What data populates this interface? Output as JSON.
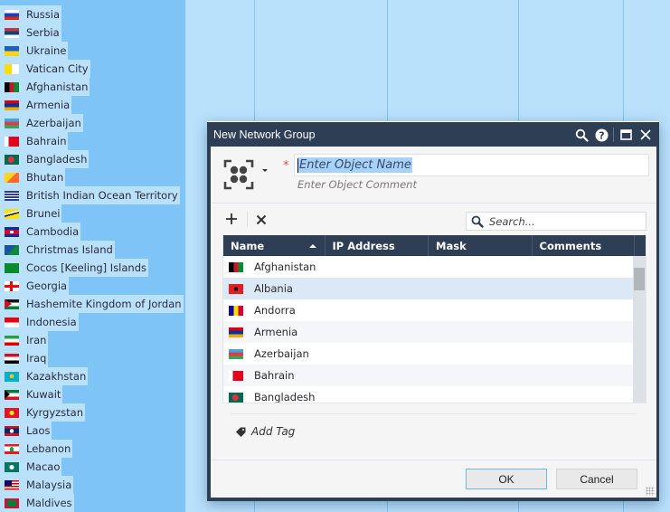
{
  "background": {
    "countries": [
      {
        "name": "Russia",
        "flag": "russia"
      },
      {
        "name": "Serbia",
        "flag": "serbia"
      },
      {
        "name": "Ukraine",
        "flag": "ukraine"
      },
      {
        "name": "Vatican City",
        "flag": "vatican"
      },
      {
        "name": "Afghanistan",
        "flag": "afghanistan"
      },
      {
        "name": "Armenia",
        "flag": "armenia"
      },
      {
        "name": "Azerbaijan",
        "flag": "azerbaijan"
      },
      {
        "name": "Bahrain",
        "flag": "bahrain"
      },
      {
        "name": "Bangladesh",
        "flag": "bangladesh"
      },
      {
        "name": "Bhutan",
        "flag": "bhutan"
      },
      {
        "name": "British Indian Ocean Territory",
        "flag": "biot"
      },
      {
        "name": "Brunei",
        "flag": "brunei"
      },
      {
        "name": "Cambodia",
        "flag": "cambodia"
      },
      {
        "name": "Christmas Island",
        "flag": "christmas"
      },
      {
        "name": "Cocos [Keeling] Islands",
        "flag": "cocos"
      },
      {
        "name": "Georgia",
        "flag": "georgia"
      },
      {
        "name": "Hashemite Kingdom of Jordan",
        "flag": "jordan"
      },
      {
        "name": "Indonesia",
        "flag": "indonesia"
      },
      {
        "name": "Iran",
        "flag": "iran"
      },
      {
        "name": "Iraq",
        "flag": "iraq"
      },
      {
        "name": "Kazakhstan",
        "flag": "kazakhstan"
      },
      {
        "name": "Kuwait",
        "flag": "kuwait"
      },
      {
        "name": "Kyrgyzstan",
        "flag": "kyrgyzstan"
      },
      {
        "name": "Laos",
        "flag": "laos"
      },
      {
        "name": "Lebanon",
        "flag": "lebanon"
      },
      {
        "name": "Macao",
        "flag": "macao"
      },
      {
        "name": "Malaysia",
        "flag": "malaysia"
      },
      {
        "name": "Maldives",
        "flag": "maldives"
      }
    ]
  },
  "dialog": {
    "title": "New Network Group",
    "titlebar_icons": [
      "search-icon",
      "help-icon",
      "maximize-icon",
      "close-icon"
    ],
    "object_icon": "network-group-icon",
    "name_input": {
      "placeholder": "Enter Object Name",
      "value": ""
    },
    "comment_placeholder": "Enter Object Comment",
    "toolbar": {
      "add_icon": "plus-icon",
      "remove_icon": "x-icon"
    },
    "search": {
      "placeholder": "Search..."
    },
    "table": {
      "columns": [
        "Name",
        "IP Address",
        "Mask",
        "Comments"
      ],
      "sort_column": "Name",
      "sort_direction": "ascending",
      "rows": [
        {
          "name": "Afghanistan",
          "flag": "afghanistan",
          "ip": "",
          "mask": "",
          "comments": ""
        },
        {
          "name": "Albania",
          "flag": "albania",
          "ip": "",
          "mask": "",
          "comments": "",
          "hover": true
        },
        {
          "name": "Andorra",
          "flag": "andorra",
          "ip": "",
          "mask": "",
          "comments": ""
        },
        {
          "name": "Armenia",
          "flag": "armenia",
          "ip": "",
          "mask": "",
          "comments": ""
        },
        {
          "name": "Azerbaijan",
          "flag": "azerbaijan",
          "ip": "",
          "mask": "",
          "comments": ""
        },
        {
          "name": "Bahrain",
          "flag": "bahrain",
          "ip": "",
          "mask": "",
          "comments": ""
        },
        {
          "name": "Bangladesh",
          "flag": "bangladesh",
          "ip": "",
          "mask": "",
          "comments": ""
        }
      ]
    },
    "add_tag_label": "Add Tag",
    "ok_label": "OK",
    "cancel_label": "Cancel"
  },
  "colors": {
    "titlebar": "#2d3e55",
    "selection": "#a6d2fb",
    "required": "#e0445a",
    "primary_border": "#6fb6e8"
  }
}
